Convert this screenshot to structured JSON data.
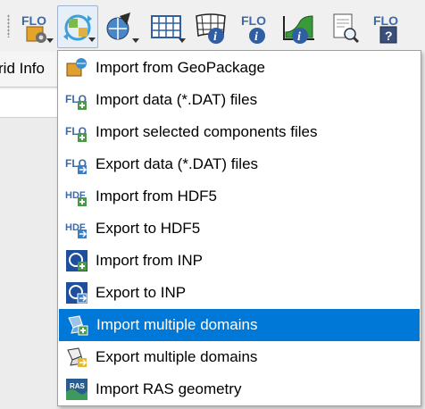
{
  "panel": {
    "tab_label": "rid Info"
  },
  "toolbar": {
    "buttons": [
      {
        "icon": "flo2d-settings-icon"
      },
      {
        "icon": "import-export-icon",
        "active": true
      },
      {
        "icon": "globe-tools-icon"
      },
      {
        "icon": "grid-table-icon"
      },
      {
        "icon": "grid-info-icon"
      },
      {
        "icon": "flo2d-info-icon"
      },
      {
        "icon": "profile-info-icon"
      },
      {
        "icon": "report-search-icon"
      },
      {
        "icon": "flo2d-help-icon"
      }
    ]
  },
  "menu": {
    "items": [
      {
        "label": "Import from GeoPackage",
        "icon": "geopackage-icon"
      },
      {
        "label": "Import data (*.DAT) files",
        "icon": "flo-import-icon"
      },
      {
        "label": "Import selected components files",
        "icon": "flo-import-icon"
      },
      {
        "label": "Export data (*.DAT) files",
        "icon": "flo-export-icon"
      },
      {
        "label": "Import from HDF5",
        "icon": "hdf-import-icon"
      },
      {
        "label": "Export to HDF5",
        "icon": "hdf-export-icon"
      },
      {
        "label": "Import from INP",
        "icon": "inp-import-icon"
      },
      {
        "label": "Export to INP",
        "icon": "inp-export-icon"
      },
      {
        "label": "Import multiple domains",
        "icon": "domains-import-icon",
        "selected": true
      },
      {
        "label": "Export multiple domains",
        "icon": "domains-export-icon"
      },
      {
        "label": "Import RAS geometry",
        "icon": "ras-icon"
      }
    ]
  }
}
